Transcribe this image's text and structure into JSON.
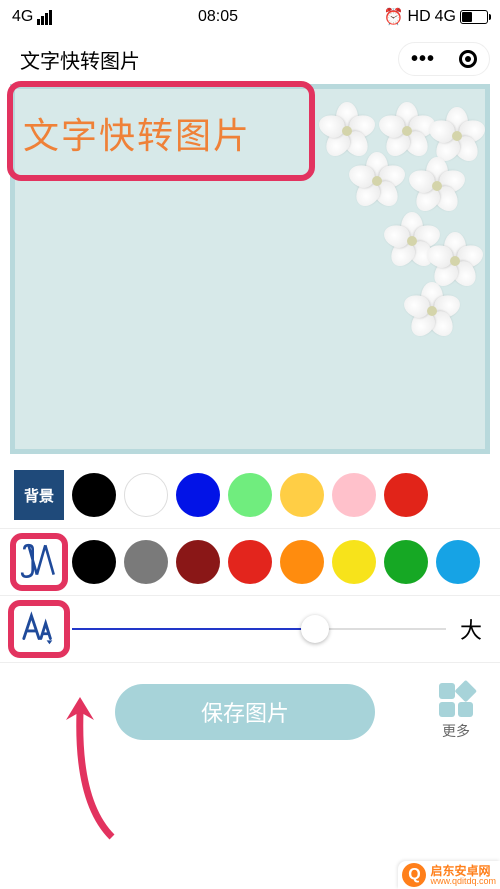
{
  "status": {
    "network": "4G",
    "time": "08:05",
    "hd": "HD",
    "net2": "4G"
  },
  "header": {
    "title": "文字快转图片"
  },
  "canvas": {
    "text": "文字快转图片"
  },
  "bg": {
    "label": "背景",
    "colors": [
      "#000000",
      "#ffffff",
      "#0213e7",
      "#70ed7e",
      "#ffce45",
      "#ffc1cb",
      "#e12419"
    ]
  },
  "textcolor": {
    "colors": [
      "#000000",
      "#7a7a7a",
      "#8a1717",
      "#e3251d",
      "#ff8c0e",
      "#f7e31b",
      "#16a824",
      "#16a3e5"
    ]
  },
  "size": {
    "max_label": "大",
    "value": 65
  },
  "actions": {
    "save": "保存图片",
    "more": "更多"
  },
  "watermark": {
    "cn": "启东安卓网",
    "en": "www.qditdq.com"
  }
}
